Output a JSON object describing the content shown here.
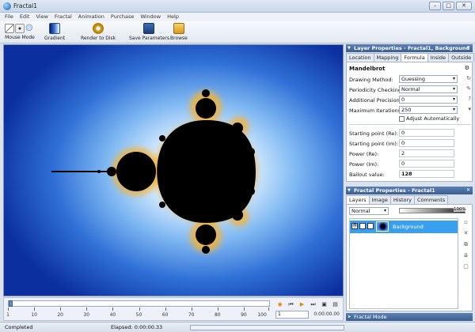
{
  "window": {
    "title": "Fractal1",
    "min": "–",
    "max": "□",
    "close": "✕"
  },
  "menu": [
    "File",
    "Edit",
    "View",
    "Fractal",
    "Animation",
    "Purchase",
    "Window",
    "Help"
  ],
  "toolbar": {
    "mouse_mode": "Mouse Mode",
    "gradient": "Gradient",
    "render": "Render to Disk",
    "save_params": "Save Parameters",
    "browse": "Browse"
  },
  "layer_props": {
    "header": "Layer Properties - Fractal1, Background",
    "tabs": [
      "Location",
      "Mapping",
      "Formula",
      "Inside",
      "Outside"
    ],
    "active_tab": "Formula",
    "formula_name": "Mandelbrot",
    "drawing_method": {
      "label": "Drawing Method:",
      "value": "Guessing"
    },
    "periodicity": {
      "label": "Periodicity Checking:",
      "value": "Normal"
    },
    "precision": {
      "label": "Additional Precision:",
      "value": "0"
    },
    "max_iter": {
      "label": "Maximum Iterations:",
      "value": "250"
    },
    "adjust": "Adjust Automatically",
    "start_re": {
      "label": "Starting point (Re):",
      "value": "0"
    },
    "start_im": {
      "label": "Starting point (Im):",
      "value": "0"
    },
    "power_re": {
      "label": "Power (Re):",
      "value": "2"
    },
    "power_im": {
      "label": "Power (Im):",
      "value": "0"
    },
    "bailout": {
      "label": "Bailout value:",
      "value": "128"
    }
  },
  "fractal_props": {
    "header": "Fractal Properties - Fractal1",
    "tabs": [
      "Layers",
      "Image",
      "History",
      "Comments"
    ],
    "active_tab": "Layers",
    "blend_mode": "Normal",
    "opacity": "100%",
    "layer_name": "Background"
  },
  "fractal_mode": "Fractal Mode",
  "timeline": {
    "ticks": [
      "1",
      "10",
      "20",
      "30",
      "40",
      "50",
      "60",
      "70",
      "80",
      "90",
      "100"
    ],
    "frame": "1",
    "time": "0:00:00.00"
  },
  "status": {
    "state": "Completed",
    "elapsed": "Elapsed: 0:00:00.33"
  }
}
